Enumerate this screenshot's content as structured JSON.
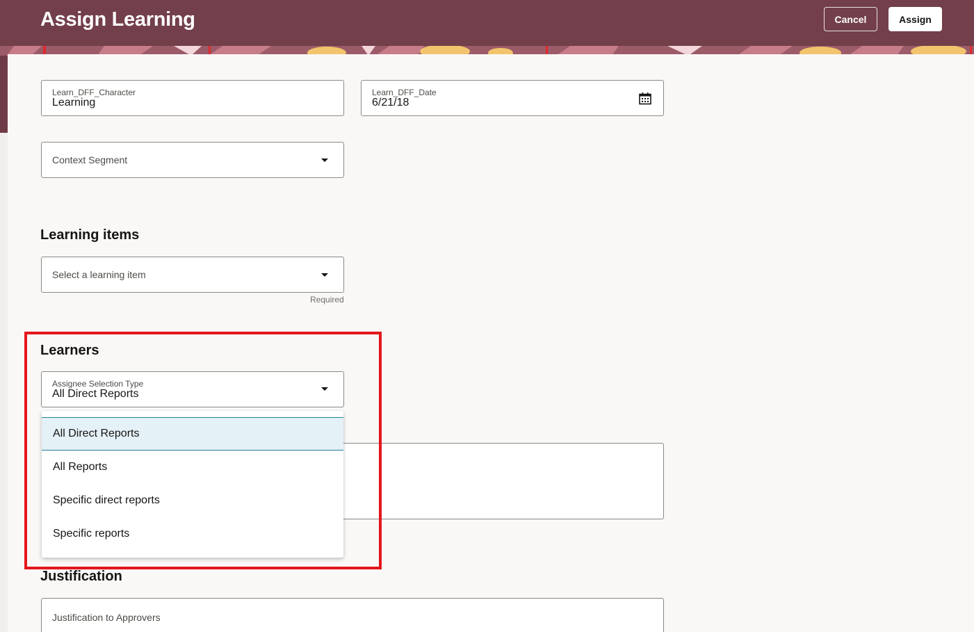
{
  "header": {
    "title": "Assign Learning",
    "cancel_label": "Cancel",
    "assign_label": "Assign"
  },
  "form": {
    "character_field": {
      "label": "Learn_DFF_Character",
      "value": "Learning"
    },
    "date_field": {
      "label": "Learn_DFF_Date",
      "value": "6/21/18",
      "icon": "calendar-icon"
    },
    "context_segment": {
      "placeholder": "Context Segment"
    }
  },
  "learning_items": {
    "heading": "Learning items",
    "select": {
      "placeholder": "Select a learning item",
      "helper": "Required"
    }
  },
  "learners": {
    "heading": "Learners",
    "assignee_select": {
      "label": "Assignee Selection Type",
      "value": "All Direct Reports"
    },
    "options": [
      {
        "label": "All Direct Reports",
        "selected": true
      },
      {
        "label": "All Reports",
        "selected": false
      },
      {
        "label": "Specific direct reports",
        "selected": false
      },
      {
        "label": "Specific reports",
        "selected": false
      }
    ]
  },
  "justification": {
    "heading": "Justification",
    "field": {
      "placeholder": "Justification to Approvers"
    }
  },
  "colors": {
    "header_bg": "#723f4a",
    "highlight": "#e3161b",
    "selected_option_bg": "#e4f1f7",
    "selected_option_border": "#227e9e"
  }
}
